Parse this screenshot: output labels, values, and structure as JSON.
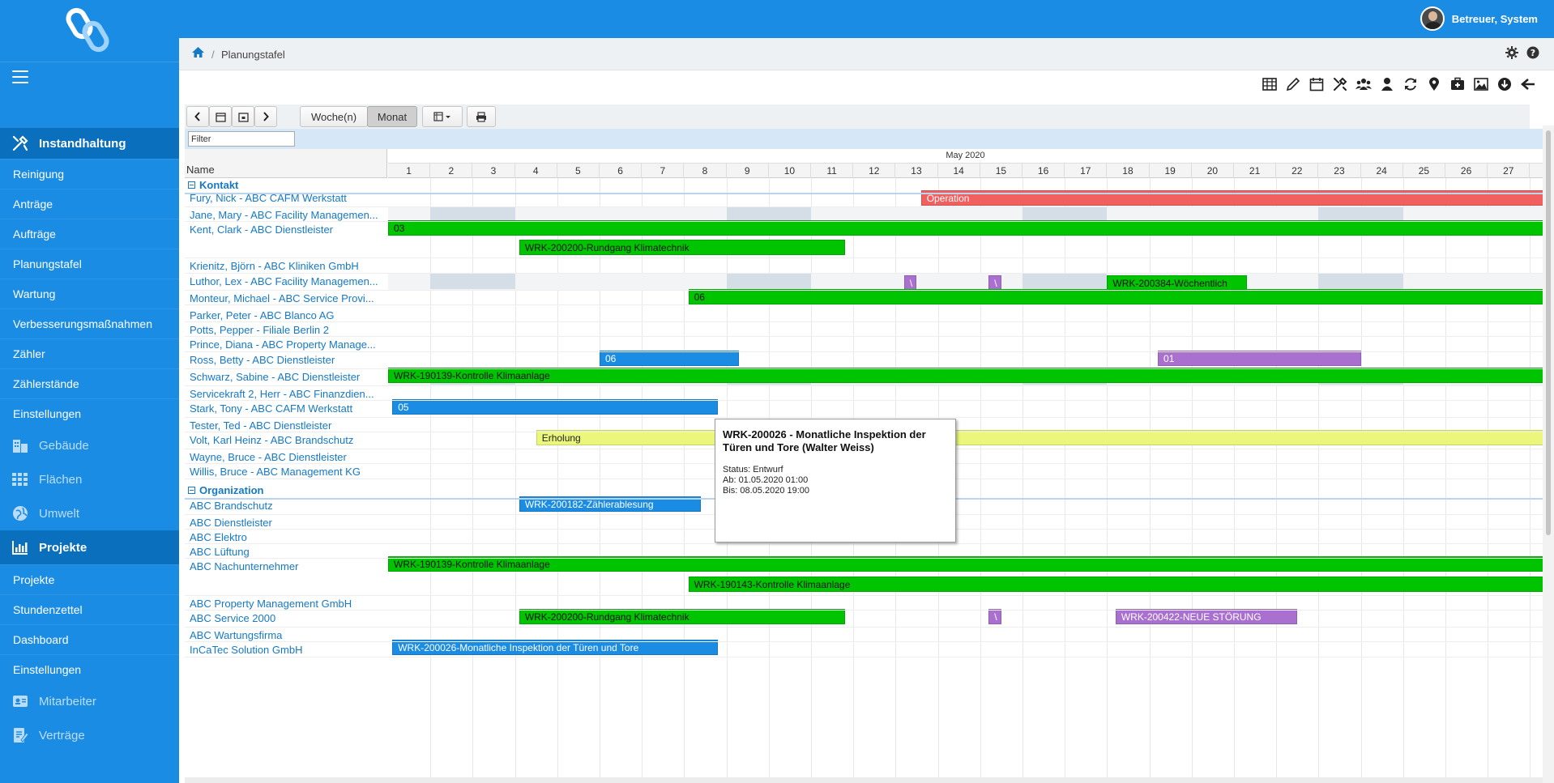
{
  "sidebar": {
    "groups": [
      {
        "label": "Instandhaltung",
        "icon": "tools-icon",
        "active": true
      },
      {
        "label": "Gebäude",
        "icon": "building-icon"
      },
      {
        "label": "Flächen",
        "icon": "grid-icon"
      },
      {
        "label": "Umwelt",
        "icon": "globe-icon"
      },
      {
        "label": "Projekte",
        "icon": "chart-icon",
        "active": true
      },
      {
        "label": "Mitarbeiter",
        "icon": "id-card-icon"
      },
      {
        "label": "Verträge",
        "icon": "contract-icon"
      }
    ],
    "instandhaltung_items": [
      "Reinigung",
      "Anträge",
      "Aufträge",
      "Planungstafel",
      "Wartung",
      "Verbesserungsmaßnahmen",
      "Zähler",
      "Zählerstände",
      "Einstellungen"
    ],
    "projekte_items": [
      "Projekte",
      "Stundenzettel",
      "Dashboard",
      "Einstellungen"
    ]
  },
  "topbar": {
    "user_name": "Betreuer, System"
  },
  "breadcrumb": {
    "current": "Planungstafel"
  },
  "controls": {
    "week_label": "Woche(n)",
    "month_label": "Monat",
    "filter_placeholder": "Filter"
  },
  "gantt": {
    "name_header": "Name",
    "month": "May 2020",
    "days": [
      "1",
      "2",
      "3",
      "4",
      "5",
      "6",
      "7",
      "8",
      "9",
      "10",
      "11",
      "12",
      "13",
      "14",
      "15",
      "16",
      "17",
      "18",
      "19",
      "20",
      "21",
      "22",
      "23",
      "24",
      "25",
      "26",
      "27"
    ],
    "groups": [
      {
        "label": "Kontakt"
      },
      {
        "label": "Organization"
      }
    ],
    "rows": [
      "Fury, Nick - ABC CAFM Werkstatt",
      "Jane, Mary - ABC Facility Managemen...",
      "Kent, Clark - ABC Dienstleister",
      "Krienitz, Björn - ABC Kliniken GmbH",
      "Luthor, Lex - ABC Facility Managemen...",
      "Monteur, Michael - ABC Service Provi...",
      "Parker, Peter - ABC Blanco AG",
      "Potts, Pepper - Filiale Berlin 2",
      "Prince, Diana - ABC Property Manage...",
      "Ross, Betty - ABC Dienstleister",
      "Schwarz, Sabine - ABC Dienstleister",
      "Servicekraft 2, Herr - ABC Finanzdien...",
      "Stark, Tony - ABC CAFM Werkstatt",
      "Tester, Ted - ABC Dienstleister",
      "Volt, Karl Heinz - ABC Brandschutz",
      "Wayne, Bruce - ABC Dienstleister",
      "Willis, Bruce - ABC Management KG",
      "ABC Brandschutz",
      "ABC Dienstleister",
      "ABC Elektro",
      "ABC Lüftung",
      "ABC Nachunternehmer",
      "ABC Property Management GmbH",
      "ABC Service 2000",
      "ABC Wartungsfirma",
      "InCaTec Solution GmbH"
    ],
    "bars": [
      {
        "label": "Operation",
        "color": "red"
      },
      {
        "label": "03",
        "color": "green"
      },
      {
        "label": "WRK-200200-Rundgang Klimatechnik",
        "color": "green"
      },
      {
        "label": "\\",
        "color": "purple"
      },
      {
        "label": "\\",
        "color": "purple"
      },
      {
        "label": "WRK-200384-Wöchentlich",
        "color": "green"
      },
      {
        "label": "06",
        "color": "green"
      },
      {
        "label": "06",
        "color": "blue"
      },
      {
        "label": "01",
        "color": "purple"
      },
      {
        "label": "WRK-190139-Kontrolle Klimaanlage",
        "color": "green"
      },
      {
        "label": "05",
        "color": "blue"
      },
      {
        "label": "Erholung",
        "color": "yellow"
      },
      {
        "label": "WRK-200182-Zählerablesung",
        "color": "blue"
      },
      {
        "label": "WRK-190139-Kontrolle Klimaanlage",
        "color": "green"
      },
      {
        "label": "WRK-190143-Kontrolle Klimaanlage",
        "color": "green"
      },
      {
        "label": "WRK-200200-Rundgang Klimatechnik",
        "color": "green"
      },
      {
        "label": "\\",
        "color": "purple"
      },
      {
        "label": "WRK-200422-NEUE STÖRUNG",
        "color": "purple"
      },
      {
        "label": "WRK-200026-Monatliche Inspektion der Türen und Tore",
        "color": "blue"
      }
    ]
  },
  "tooltip": {
    "title": "WRK-200026 - Monatliche Inspektion der Türen und Tore (Walter Weiss)",
    "status": "Status: Entwurf",
    "from": "Ab: 01.05.2020 01:00",
    "to": "Bis: 08.05.2020 19:00"
  },
  "colors": {
    "sidebar": "#1b8ce4",
    "sidebar_active": "#0a6fbd",
    "bar_green": "#00c400",
    "bar_red": "#f25f5f",
    "bar_blue": "#1b8ce4",
    "bar_purple": "#a970cf",
    "bar_yellow": "#eaf77c"
  }
}
